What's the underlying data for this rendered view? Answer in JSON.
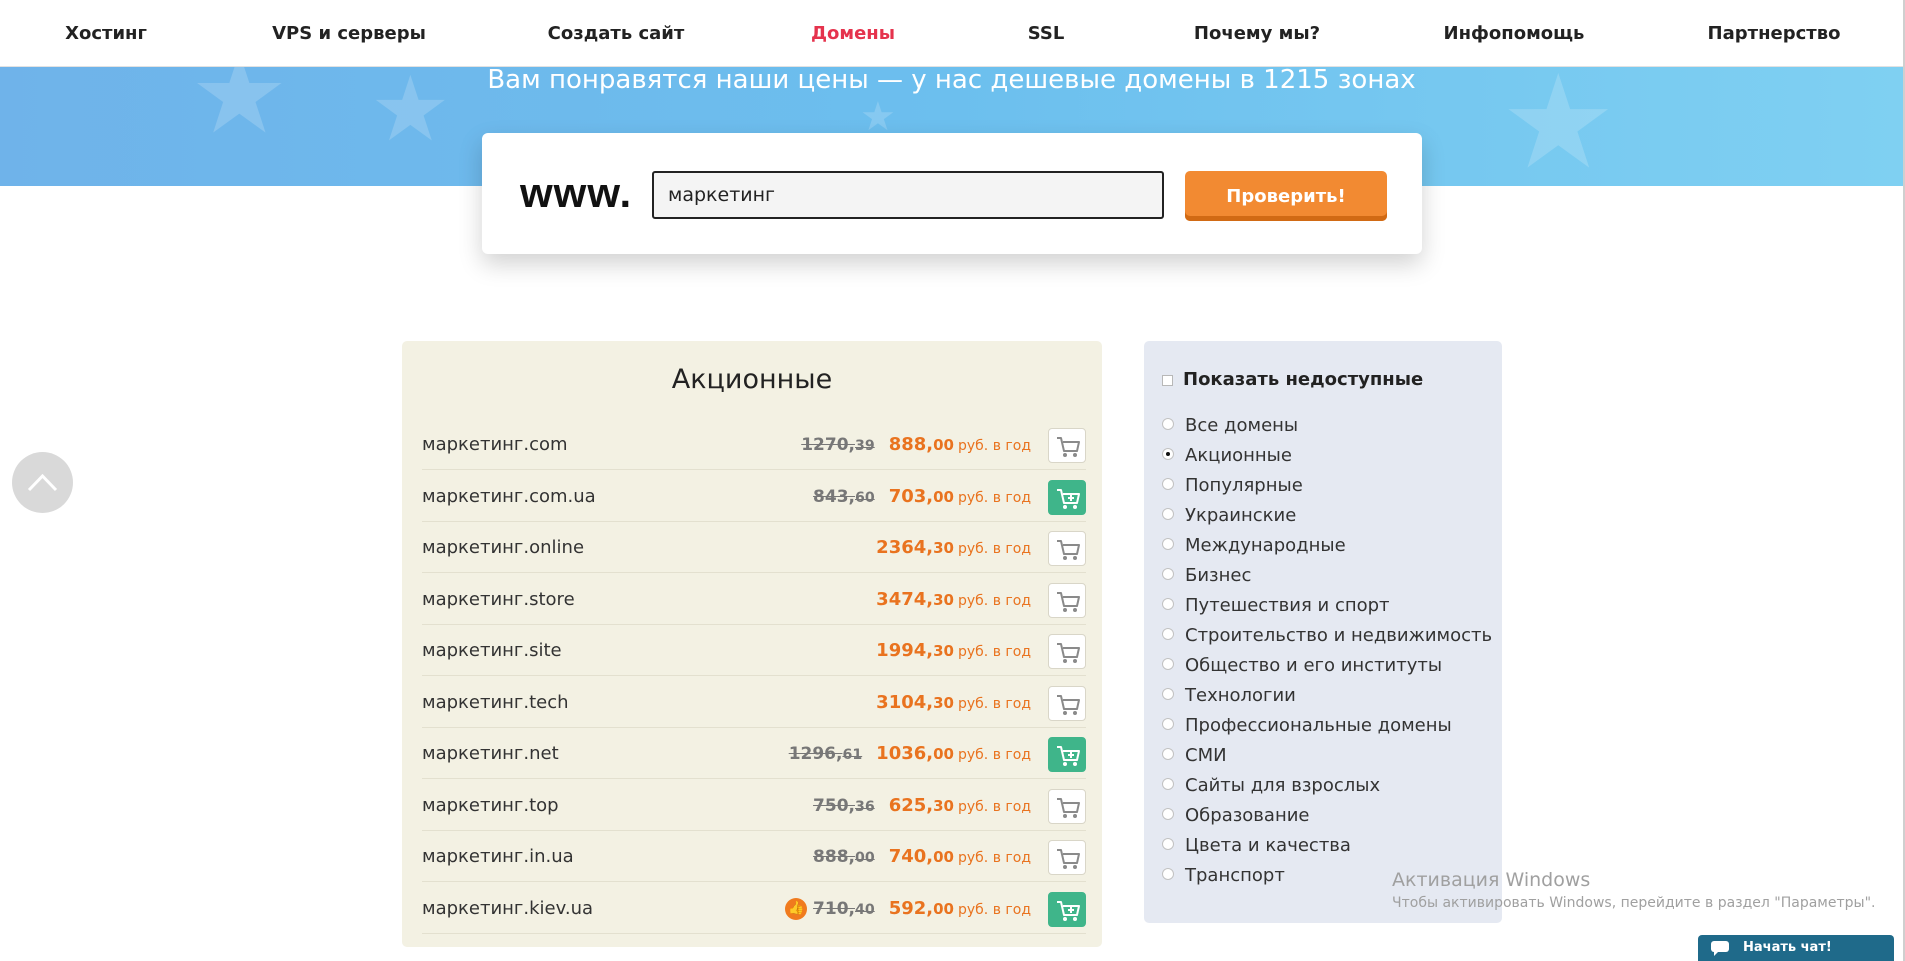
{
  "nav": {
    "items": [
      {
        "label": "Хостинг",
        "active": false
      },
      {
        "label": "VPS и серверы",
        "active": false
      },
      {
        "label": "Создать сайт",
        "active": false
      },
      {
        "label": "Домены",
        "active": true
      },
      {
        "label": "SSL",
        "active": false
      },
      {
        "label": "Почему мы?",
        "active": false
      },
      {
        "label": "Инфопомощь",
        "active": false
      },
      {
        "label": "Партнерство",
        "active": false
      }
    ]
  },
  "hero": {
    "title": "Вам понравятся наши цены — у нас дешевые домены в 1215 зонах"
  },
  "search": {
    "prefix": "www.",
    "value": "маркетинг",
    "button_label": "Проверить!"
  },
  "promo": {
    "title": "Акционные",
    "rows": [
      {
        "name": "маркетинг.com",
        "old_int": "1270,",
        "old_frac": "39",
        "new_int": "888,",
        "new_frac": "00",
        "unit": "руб. в год",
        "cart": "grey"
      },
      {
        "name": "маркетинг.com.ua",
        "old_int": "843,",
        "old_frac": "60",
        "new_int": "703,",
        "new_frac": "00",
        "unit": "руб. в год",
        "cart": "green"
      },
      {
        "name": "маркетинг.online",
        "old_int": "",
        "old_frac": "",
        "new_int": "2364,",
        "new_frac": "30",
        "unit": "руб. в год",
        "cart": "grey"
      },
      {
        "name": "маркетинг.store",
        "old_int": "",
        "old_frac": "",
        "new_int": "3474,",
        "new_frac": "30",
        "unit": "руб. в год",
        "cart": "grey"
      },
      {
        "name": "маркетинг.site",
        "old_int": "",
        "old_frac": "",
        "new_int": "1994,",
        "new_frac": "30",
        "unit": "руб. в год",
        "cart": "grey"
      },
      {
        "name": "маркетинг.tech",
        "old_int": "",
        "old_frac": "",
        "new_int": "3104,",
        "new_frac": "30",
        "unit": "руб. в год",
        "cart": "grey"
      },
      {
        "name": "маркетинг.net",
        "old_int": "1296,",
        "old_frac": "61",
        "new_int": "1036,",
        "new_frac": "00",
        "unit": "руб. в год",
        "cart": "green"
      },
      {
        "name": "маркетинг.top",
        "old_int": "750,",
        "old_frac": "36",
        "new_int": "625,",
        "new_frac": "30",
        "unit": "руб. в год",
        "cart": "grey"
      },
      {
        "name": "маркетинг.in.ua",
        "old_int": "888,",
        "old_frac": "00",
        "new_int": "740,",
        "new_frac": "00",
        "unit": "руб. в год",
        "cart": "grey"
      },
      {
        "name": "маркетинг.kiev.ua",
        "old_int": "710,",
        "old_frac": "40",
        "new_int": "592,",
        "new_frac": "00",
        "unit": "руб. в год",
        "cart": "green",
        "hot": true
      }
    ]
  },
  "filters": {
    "show_unavailable_label": "Показать недоступные",
    "show_unavailable_checked": false,
    "selected": "Акционные",
    "options": [
      "Все домены",
      "Акционные",
      "Популярные",
      "Украинские",
      "Международные",
      "Бизнес",
      "Путешествия и спорт",
      "Строительство и недвижимость",
      "Общество и его институты",
      "Технологии",
      "Профессиональные домены",
      "СМИ",
      "Сайты для взрослых",
      "Образование",
      "Цвета и качества",
      "Транспорт"
    ]
  },
  "watermark": {
    "title": "Активация Windows",
    "text": "Чтобы активировать Windows, перейдите в раздел \"Параметры\"."
  },
  "chat": {
    "label": "Начать чат!"
  },
  "colors": {
    "accent_orange": "#e9731f",
    "button_orange": "#f28a32",
    "active_nav": "#e5334d",
    "cart_green": "#3fb58a"
  }
}
